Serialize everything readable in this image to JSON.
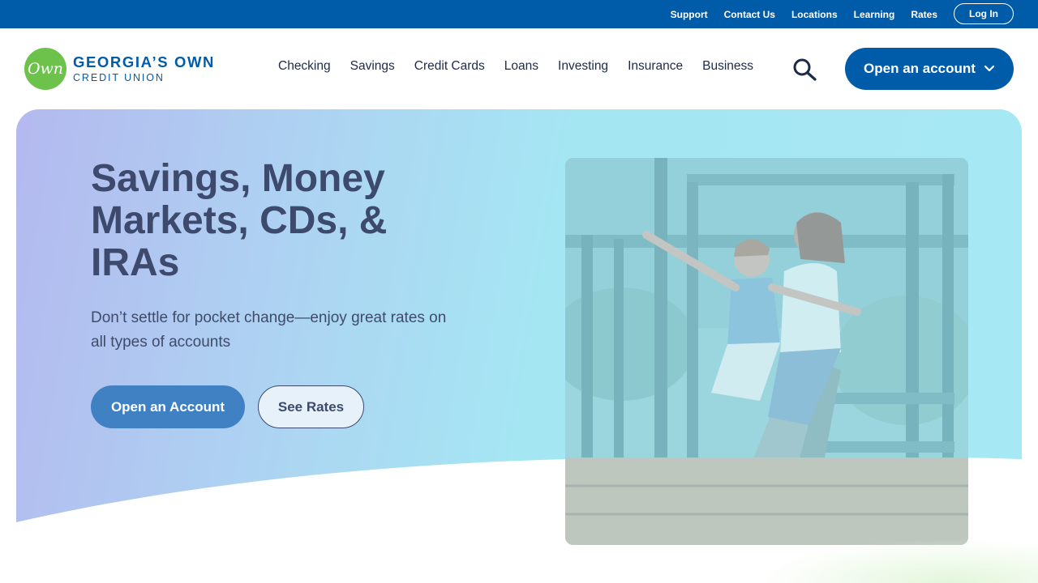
{
  "utility": {
    "links": [
      "Support",
      "Contact Us",
      "Locations",
      "Learning",
      "Rates"
    ],
    "login_label": "Log In"
  },
  "brand": {
    "mark_text": "Own",
    "name_line1": "GEORGIA’S OWN",
    "name_line2": "CREDIT UNION",
    "primary_color": "#005ca9",
    "mark_color": "#6cc24a"
  },
  "nav": {
    "items": [
      "Checking",
      "Savings",
      "Credit Cards",
      "Loans",
      "Investing",
      "Insurance",
      "Business"
    ],
    "search_icon": "search-icon",
    "open_account_label": "Open an account",
    "open_account_icon": "chevron-down-icon"
  },
  "hero": {
    "title": "Savings, Money Markets, CDs, & IRAs",
    "subtitle": "Don’t settle for pocket change—enjoy great rates on all types of accounts",
    "primary_button": "Open an Account",
    "secondary_button": "See Rates",
    "image_subject": "woman-and-child-on-slide-photo"
  }
}
